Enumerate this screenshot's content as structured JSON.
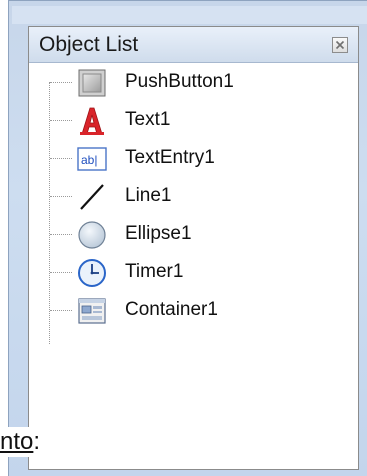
{
  "panel": {
    "title": "Object List"
  },
  "tree": {
    "items": [
      {
        "label": "PushButton1",
        "icon": "pushbutton-icon"
      },
      {
        "label": "Text1",
        "icon": "text-icon"
      },
      {
        "label": "TextEntry1",
        "icon": "textentry-icon"
      },
      {
        "label": "Line1",
        "icon": "line-icon"
      },
      {
        "label": "Ellipse1",
        "icon": "ellipse-icon"
      },
      {
        "label": "Timer1",
        "icon": "timer-icon"
      },
      {
        "label": "Container1",
        "icon": "container-icon"
      }
    ]
  },
  "background_text": {
    "underlined": "nto",
    "suffix": ":"
  },
  "colors": {
    "frame": "#c7d6ea",
    "header": "#dbe6f4",
    "text": "#111111",
    "text_icon_red": "#d9242a",
    "textentry_blue": "#1f4fbf"
  },
  "textentry_glyph": "ab|"
}
